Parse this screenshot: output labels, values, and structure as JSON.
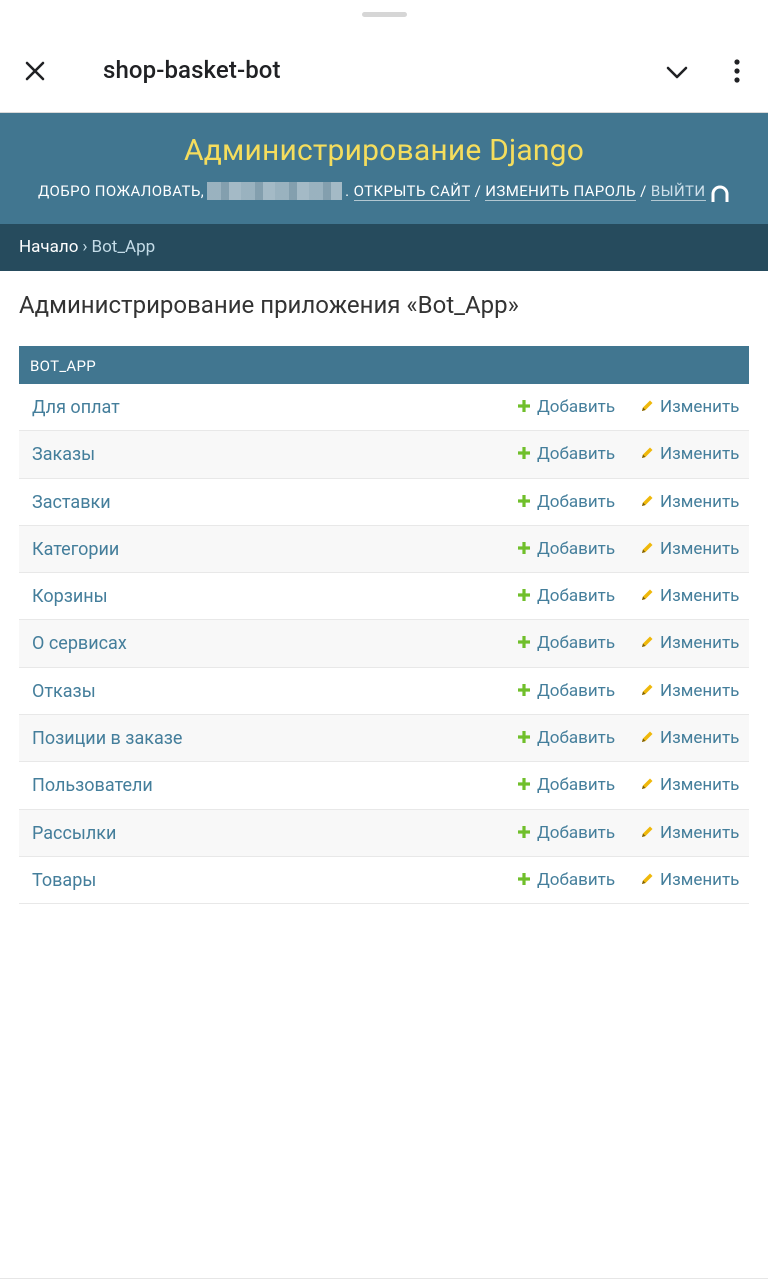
{
  "app_bar": {
    "title": "shop-basket-bot"
  },
  "django_header": {
    "branding": "Администрирование Django",
    "welcome": "ДОБРО ПОЖАЛОВАТЬ,",
    "view_site": "ОТКРЫТЬ САЙТ",
    "change_password": "ИЗМЕНИТЬ ПАРОЛЬ",
    "logout": "ВЫЙТИ",
    "separator": "/"
  },
  "breadcrumbs": {
    "home": "Начало",
    "separator": "›",
    "current": "Bot_App"
  },
  "page_title": "Администрирование приложения «Bot_App»",
  "module": {
    "caption": "BOT_APP",
    "add_label": "Добавить",
    "change_label": "Изменить",
    "models": [
      {
        "name": "Для оплат"
      },
      {
        "name": "Заказы"
      },
      {
        "name": "Заставки"
      },
      {
        "name": "Категории"
      },
      {
        "name": "Корзины"
      },
      {
        "name": "О сервисах"
      },
      {
        "name": "Отказы"
      },
      {
        "name": "Позиции в заказе"
      },
      {
        "name": "Пользователи"
      },
      {
        "name": "Рассылки"
      },
      {
        "name": "Товары"
      }
    ]
  },
  "colors": {
    "header_bg": "#417690",
    "branding": "#f5dd5d",
    "breadcrumbs_bg": "#264b5d",
    "link": "#447e9b",
    "add_icon": "#70bf2b",
    "change_icon": "#efb80b"
  }
}
